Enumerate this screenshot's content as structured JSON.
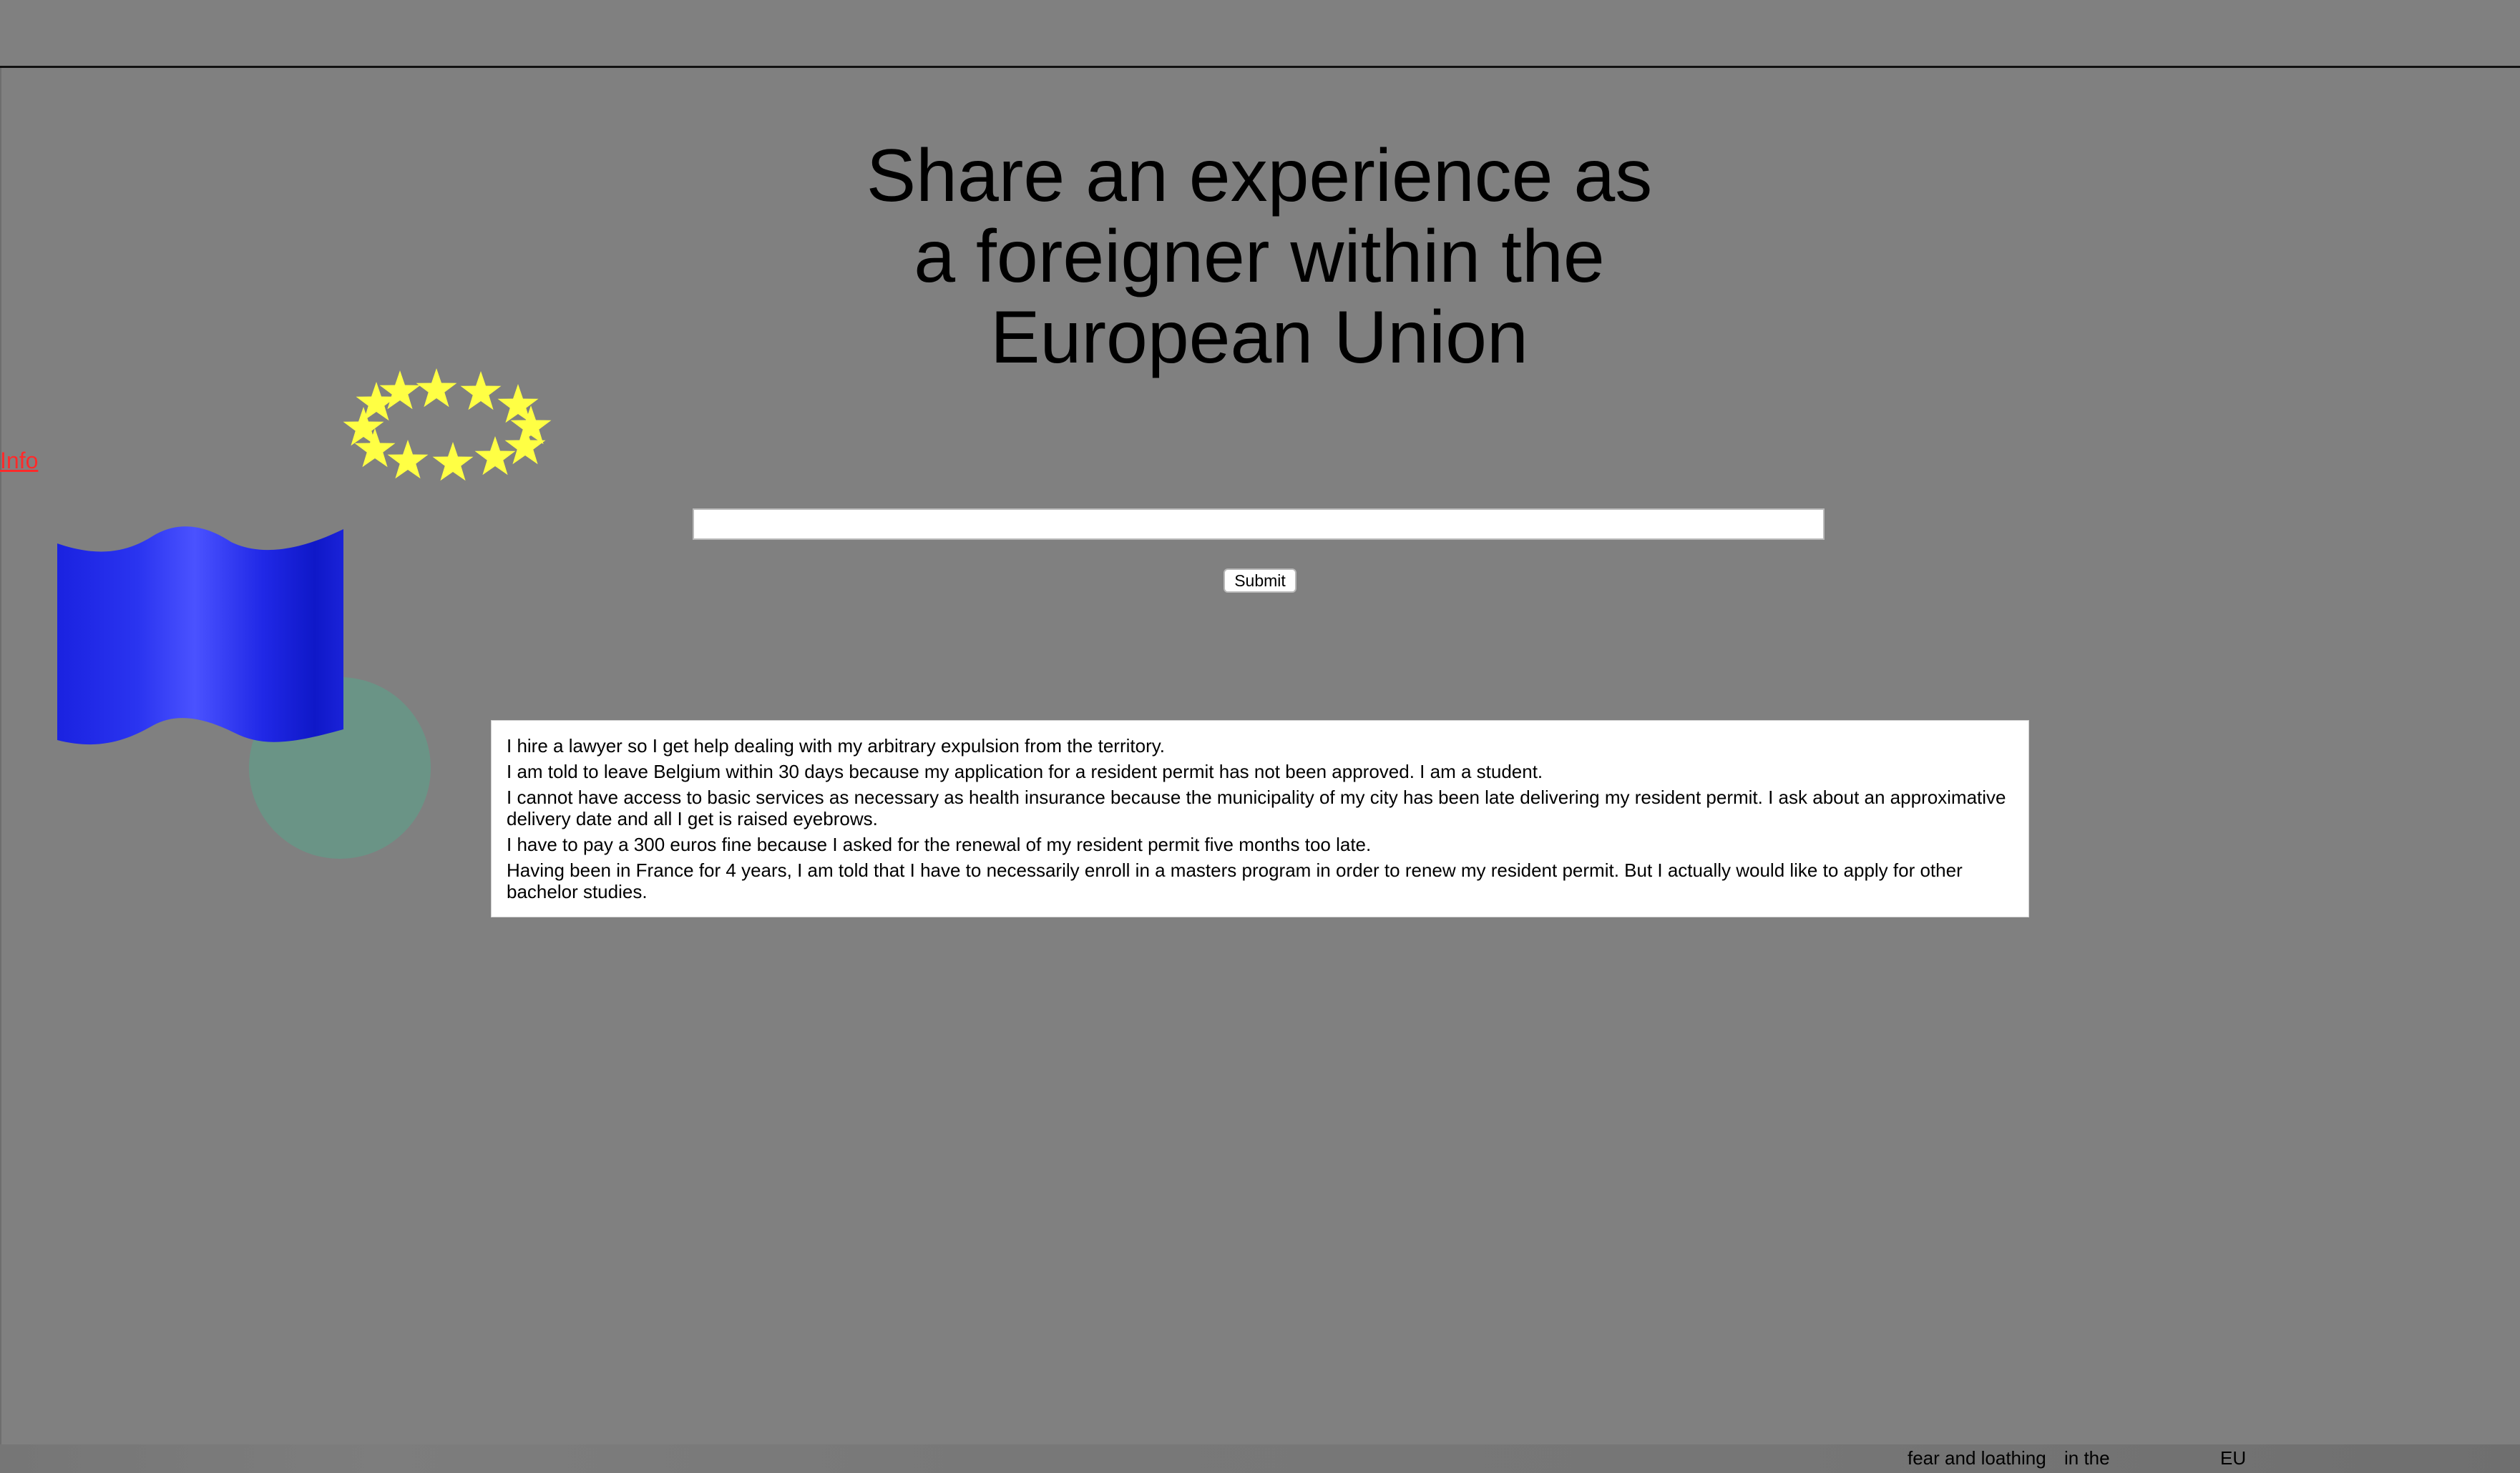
{
  "header": {
    "title_line1": "Share an experience as",
    "title_line2": "a foreigner within the",
    "title_line3": "European Union"
  },
  "nav": {
    "info_link": "Info"
  },
  "form": {
    "input_value": "",
    "input_placeholder": "",
    "submit_label": "Submit"
  },
  "experiences": [
    "I hire a lawyer so I get help dealing with my arbitrary expulsion from the territory.",
    "I am told to leave Belgium within 30 days because my application for a resident permit has not been approved. I am a student.",
    "I cannot have access to basic services as necessary as health insurance because the municipality of my city has been late delivering my resident permit. I ask about an approximative delivery date and all I get is raised eyebrows.",
    "I have to pay a 300 euros fine because I asked for the renewal of my resident permit five months too late.",
    "Having been in France for 4 years, I am told that I have to necessarily enroll in a masters program in order to renew my resident permit. But I actually would like to apply for other bachelor studies."
  ],
  "footer": {
    "part1": "fear and loathing",
    "part2": "in the",
    "part3": "EU"
  },
  "colors": {
    "background": "#808080",
    "flag_blue": "#1a22e0",
    "star_yellow": "#ffff44",
    "circle_green": "#6a9486",
    "link_red": "#ff2a2a"
  },
  "decorations": {
    "star_count": 12
  }
}
